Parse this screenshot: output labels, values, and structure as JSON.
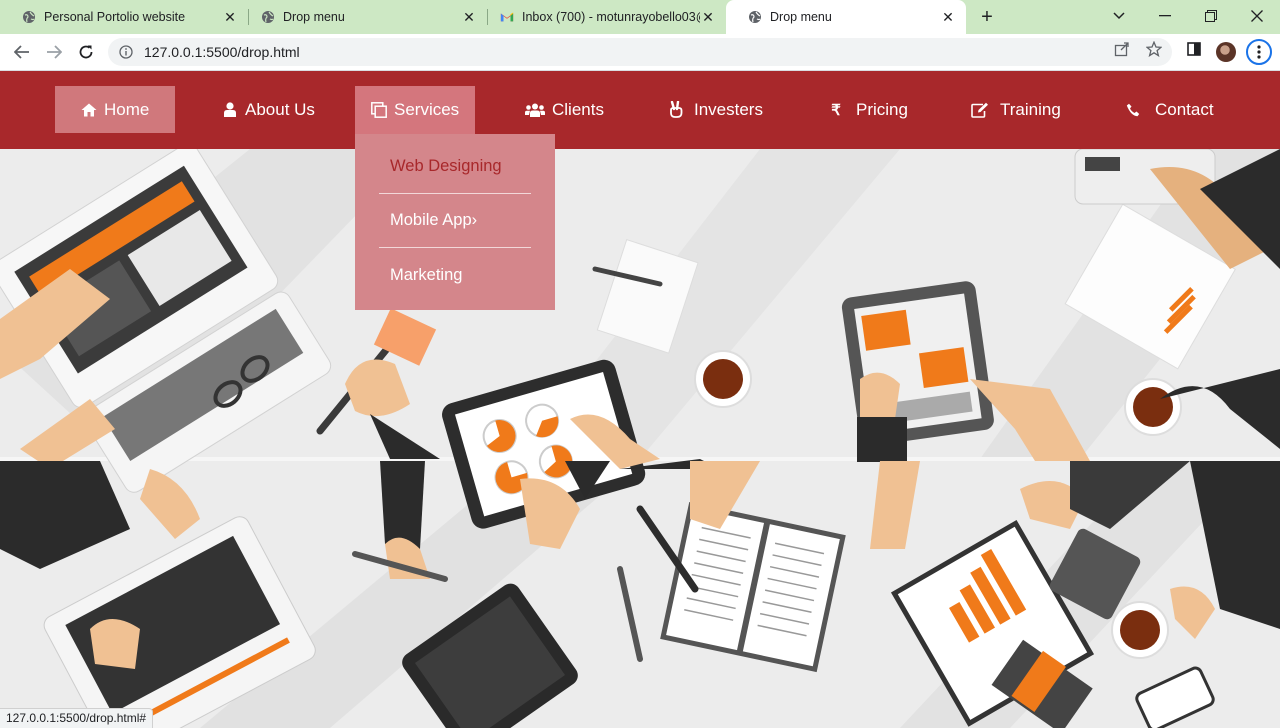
{
  "browser": {
    "tabs": [
      {
        "title": "Personal Portolio website",
        "icon": "globe-icon",
        "active": false
      },
      {
        "title": "Drop menu",
        "icon": "globe-icon",
        "active": false
      },
      {
        "title": "Inbox (700) - motunrayobello03@",
        "icon": "gmail-icon",
        "active": false
      },
      {
        "title": "Drop menu",
        "icon": "globe-icon",
        "active": true
      }
    ],
    "url": "127.0.0.1:5500/drop.html",
    "status_url": "127.0.0.1:5500/drop.html#"
  },
  "nav": {
    "items": [
      {
        "label": "Home",
        "icon": "home-icon"
      },
      {
        "label": "About Us",
        "icon": "user-icon"
      },
      {
        "label": "Services",
        "icon": "clone-icon"
      },
      {
        "label": "Clients",
        "icon": "users-icon"
      },
      {
        "label": "Investers",
        "icon": "hand-peace-icon"
      },
      {
        "label": "Pricing",
        "icon": "rupee-icon"
      },
      {
        "label": "Training",
        "icon": "edit-icon"
      },
      {
        "label": "Contact",
        "icon": "phone-icon"
      }
    ]
  },
  "dropdown": {
    "items": [
      {
        "label": "Web Designing"
      },
      {
        "label": "Mobile App"
      },
      {
        "label": "Marketing"
      }
    ],
    "submenu_indicator": "›"
  },
  "colors": {
    "nav_bg": "#a8282b",
    "nav_active": "#d0787c",
    "dropdown_bg": "#d4868b",
    "tab_strip": "#cde8c4"
  }
}
